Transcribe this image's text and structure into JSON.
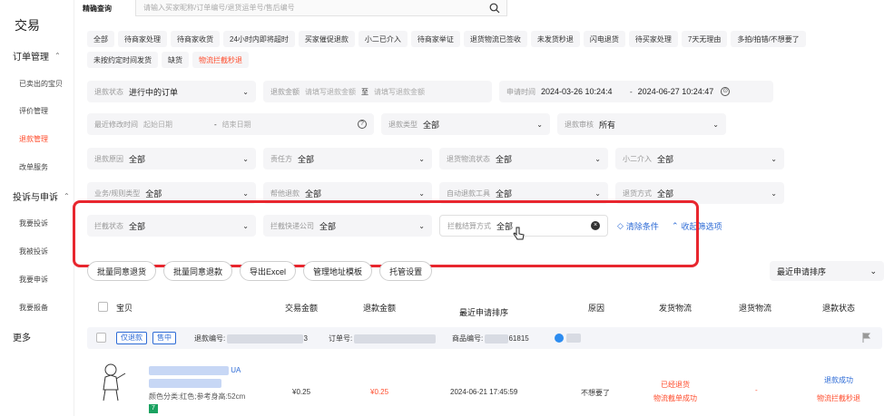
{
  "sidebar": {
    "title": "交易",
    "groups": [
      {
        "label": "订单管理",
        "items": [
          "已卖出的宝贝",
          "评价管理",
          "退款管理",
          "改单服务"
        ]
      },
      {
        "label": "投诉与申诉",
        "items": [
          "我要投诉",
          "我被投诉",
          "我要申诉",
          "我要报备"
        ]
      }
    ],
    "more": "更多",
    "active_item": "退款管理"
  },
  "search": {
    "label": "精确查询",
    "placeholder": "请输入买家昵称/订单编号/退货运单号/售后编号"
  },
  "chips": [
    "全部",
    "待商家处理",
    "待商家收货",
    "24小时内即将超时",
    "买家催促退款",
    "小二已介入",
    "待商家举证",
    "退货物流已签收",
    "未发货秒退",
    "闪电退货",
    "待买家处理",
    "7天无理由",
    "多拍/拍错/不想要了",
    "未按约定时间发货",
    "缺货",
    "物流拦截秒退"
  ],
  "active_chip": "物流拦截秒退",
  "filters": {
    "refund_status": {
      "label": "退款状态",
      "value": "进行中的订单"
    },
    "refund_amount": {
      "label": "退款金额",
      "placeholder_min": "请填写退款金额",
      "sep": "至",
      "placeholder_max": "请填写退款金额"
    },
    "apply_time": {
      "label": "申请时间",
      "start": "2024-03-26 10:24:4",
      "sep": "-",
      "end": "2024-06-27 10:24:47"
    },
    "last_modified": {
      "label": "最近修改时间",
      "start_ph": "起始日期",
      "sep": "-",
      "end_ph": "结束日期"
    },
    "refund_type": {
      "label": "退款类型",
      "value": "全部"
    },
    "refund_audit": {
      "label": "退款审核",
      "value": "所有"
    },
    "refund_reason": {
      "label": "退款原因",
      "value": "全部"
    },
    "responsible": {
      "label": "责任方",
      "value": "全部"
    },
    "return_logistics_status": {
      "label": "退货物流状态",
      "value": "全部"
    },
    "xiaoer": {
      "label": "小二介入",
      "value": "全部"
    },
    "business_type": {
      "label": "业务/规则类型",
      "value": "全部"
    },
    "help_refund": {
      "label": "帮他退款",
      "value": "全部"
    },
    "auto_refund_tool": {
      "label": "自动退款工具",
      "value": "全部"
    },
    "return_method": {
      "label": "退货方式",
      "value": "全部"
    },
    "intercept_status": {
      "label": "拦截状态",
      "value": "全部"
    },
    "intercept_courier": {
      "label": "拦截快递公司",
      "value": "全部"
    },
    "intercept_settle": {
      "label": "拦截结算方式",
      "value": "全部"
    },
    "clear_label": "清除条件",
    "collapse_label": "收起筛选项"
  },
  "actions": [
    "批量同意退货",
    "批量同意退款",
    "导出Excel",
    "管理地址模板",
    "托管设置"
  ],
  "sort_select": "最近申请排序",
  "table": {
    "headers": {
      "item": "宝贝",
      "trade_amount": "交易金额",
      "refund_amount": "退款金额",
      "apply_sort": "最近申请排序",
      "reason": "原因",
      "ship_logistics": "发货物流",
      "return_logistics": "退货物流",
      "refund_status": "退款状态"
    }
  },
  "order": {
    "tags": [
      "仅退款",
      "售中"
    ],
    "refund_no_label": "退款编号:",
    "refund_no_tail": "3",
    "order_no_label": "订单号:",
    "goods_no_label": "商品编号:",
    "goods_no_tail": "61815",
    "title_tail": "UA",
    "sku": "颜色分类:红色;参考身高:52cm",
    "badge": "7",
    "trade_amount": "¥0.25",
    "refund_amount": "¥0.25",
    "apply_time": "2024-06-21 17:45:59",
    "reason": "不想要了",
    "ship_status_1": "已经退货",
    "ship_status_2": "物流截单成功",
    "return_logistics": "-",
    "refund_status_1": "退款成功",
    "refund_status_2": "物流拦截秒退"
  },
  "colors": {
    "accent": "#ff4d2d",
    "link": "#2d6bd6",
    "highlight": "#e8262e"
  }
}
